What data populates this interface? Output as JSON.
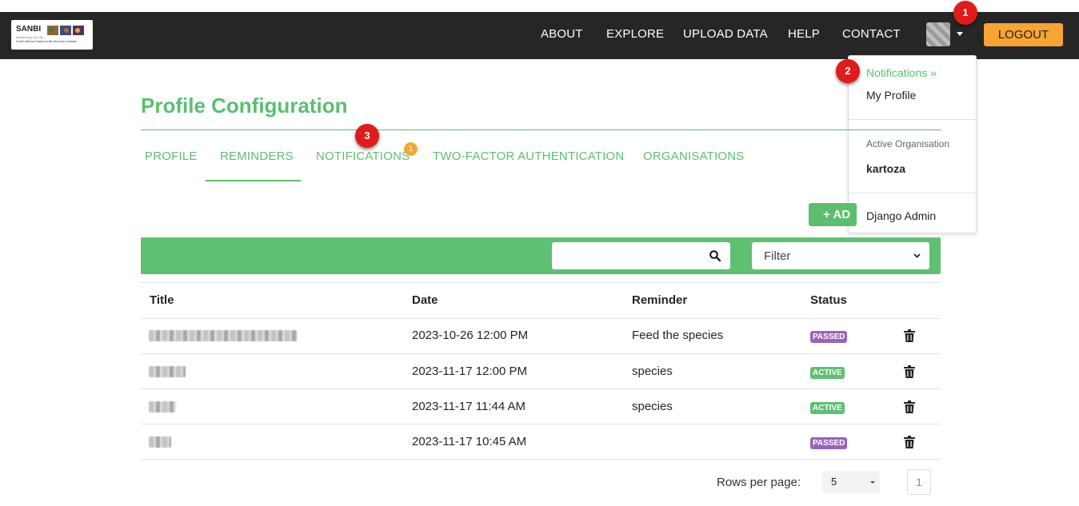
{
  "brand": {
    "logo_text": "SANBI",
    "logo_subtitle": "Biodiversity for Life",
    "logo_caption": "South African National Biodiversity Institute"
  },
  "nav": {
    "links": [
      "ABOUT",
      "EXPLORE",
      "UPLOAD DATA",
      "HELP",
      "CONTACT"
    ],
    "logout_label": "LOGOUT"
  },
  "markers": [
    "1",
    "2",
    "3"
  ],
  "user_menu": {
    "notifications": "Notifications »",
    "my_profile": "My Profile",
    "active_org_label": "Active Organisation",
    "active_org_value": "kartoza",
    "django_admin": "Django Admin"
  },
  "page": {
    "title": "Profile Configuration",
    "tabs": [
      "PROFILE",
      "REMINDERS",
      "NOTIFICATIONS",
      "TWO-FACTOR AUTHENTICATION",
      "ORGANISATIONS"
    ],
    "active_tab": "REMINDERS",
    "notifications_badge": "1",
    "add_button_label": "+ AD"
  },
  "toolbar": {
    "search_value": "",
    "filter_label": "Filter"
  },
  "table": {
    "headers": [
      "Title",
      "Date",
      "Reminder",
      "Status"
    ],
    "rows": [
      {
        "date": "2023-10-26 12:00 PM",
        "reminder": "Feed the species",
        "status": "PASSED"
      },
      {
        "date": "2023-11-17 12:00 PM",
        "reminder": "species",
        "status": "ACTIVE"
      },
      {
        "date": "2023-11-17 11:44 AM",
        "reminder": "species",
        "status": "ACTIVE"
      },
      {
        "date": "2023-11-17 10:45 AM",
        "reminder": "",
        "status": "PASSED"
      }
    ]
  },
  "pagination": {
    "rows_per_page_label": "Rows per page:",
    "rows_per_page_value": "5",
    "current_page": "1"
  },
  "colors": {
    "nav_bg": "#262626",
    "accent_green": "#5bbf6f",
    "logout_orange": "#f6a532",
    "status_active": "#5fbf73",
    "status_passed": "#9b63b8",
    "marker_red": "#e01b1b"
  }
}
